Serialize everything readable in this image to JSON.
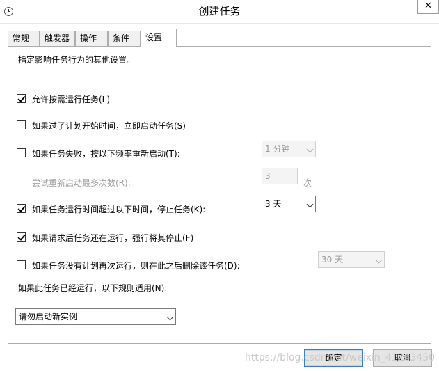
{
  "window": {
    "title": "创建任务",
    "close_glyph": "✕"
  },
  "tabs": [
    {
      "label": "常规"
    },
    {
      "label": "触发器"
    },
    {
      "label": "操作"
    },
    {
      "label": "条件"
    },
    {
      "label": "设置"
    }
  ],
  "settings": {
    "description": "指定影响任务行为的其他设置。",
    "allow_on_demand": {
      "label": "允许按需运行任务(L)",
      "checked": true
    },
    "run_missed": {
      "label": "如果过了计划开始时间，立即启动任务(S)",
      "checked": false
    },
    "restart_on_fail": {
      "label": "如果任务失败，按以下频率重新启动(T):",
      "checked": false,
      "interval": "1 分钟"
    },
    "restart_attempts": {
      "label": "尝试重新启动最多次数(R):",
      "value": "3",
      "unit": "次"
    },
    "stop_if_longer": {
      "label": "如果任务运行时间超过以下时间，停止任务(K):",
      "checked": true,
      "duration": "3 天"
    },
    "force_stop": {
      "label": "如果请求后任务还在运行，强行将其停止(F)",
      "checked": true
    },
    "delete_if_not_scheduled": {
      "label": "如果任务没有计划再次运行，则在此之后删除该任务(D):",
      "checked": false,
      "after": "30 天"
    },
    "rule_label": "如果此任务已经运行，以下规则适用(N):",
    "rule_value": "请勿启动新实例"
  },
  "buttons": {
    "ok": "确定",
    "cancel": "取消"
  },
  "watermark": "https://blog.csdn.net/weixin_41263450"
}
